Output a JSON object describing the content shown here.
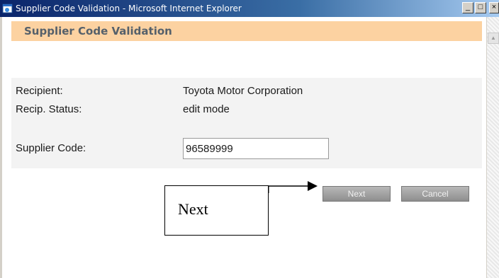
{
  "window": {
    "title": "Supplier Code Validation - Microsoft Internet Explorer",
    "controls": {
      "minimize": "_",
      "maximize": "□",
      "close": "×"
    }
  },
  "page": {
    "heading": "Supplier Code Validation",
    "fields": {
      "recipient_label": "Recipient:",
      "recipient_value": "Toyota Motor Corporation",
      "status_label": "Recip. Status:",
      "status_value": "edit mode",
      "supplier_code_label": "Supplier Code:",
      "supplier_code_value": "96589999"
    },
    "buttons": {
      "next": "Next",
      "cancel": "Cancel"
    }
  },
  "annotation": {
    "callout_text": "Next"
  },
  "icons": {
    "window_icon": "ie-page-icon",
    "scroll_up": "triangle-up-icon",
    "callout_arrow": "arrow-right-icon"
  },
  "colors": {
    "titlebar_start": "#0a246a",
    "titlebar_end": "#a6caf0",
    "banner": "#fcd2a1",
    "heading_text": "#55606a",
    "button_gray": "#9e9e9e"
  }
}
